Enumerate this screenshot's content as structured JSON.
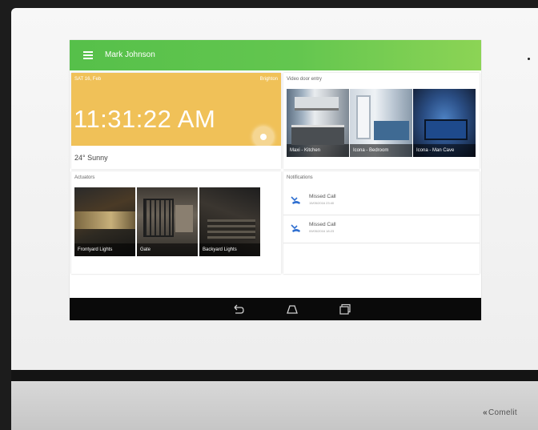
{
  "header": {
    "user_name": "Mark Johnson"
  },
  "clock": {
    "date": "SAT 16, Feb",
    "city": "Brighton",
    "time": "11:31:22 AM",
    "weather": "24° Sunny"
  },
  "video": {
    "title": "Video door entry",
    "tiles": [
      {
        "label": "Maxi - Kitchen"
      },
      {
        "label": "Icona - Bedroom"
      },
      {
        "label": "Icona - Man Cave"
      }
    ]
  },
  "actuators": {
    "title": "Actuators",
    "tiles": [
      {
        "label": "Frontyard Lights"
      },
      {
        "label": "Gate"
      },
      {
        "label": "Backyard Lights"
      }
    ]
  },
  "notifications": {
    "title": "Notifications",
    "items": [
      {
        "label": "Missed Call",
        "time": "15/05/2016 23:40"
      },
      {
        "label": "Missed Call",
        "time": "09/05/2016 18:23"
      }
    ]
  },
  "brand": {
    "mark": "«",
    "name": "Comelit"
  },
  "colors": {
    "accent_green": "#5ec24c",
    "clock_yellow": "#f0c158",
    "missed_call_blue": "#2f6fd0"
  }
}
